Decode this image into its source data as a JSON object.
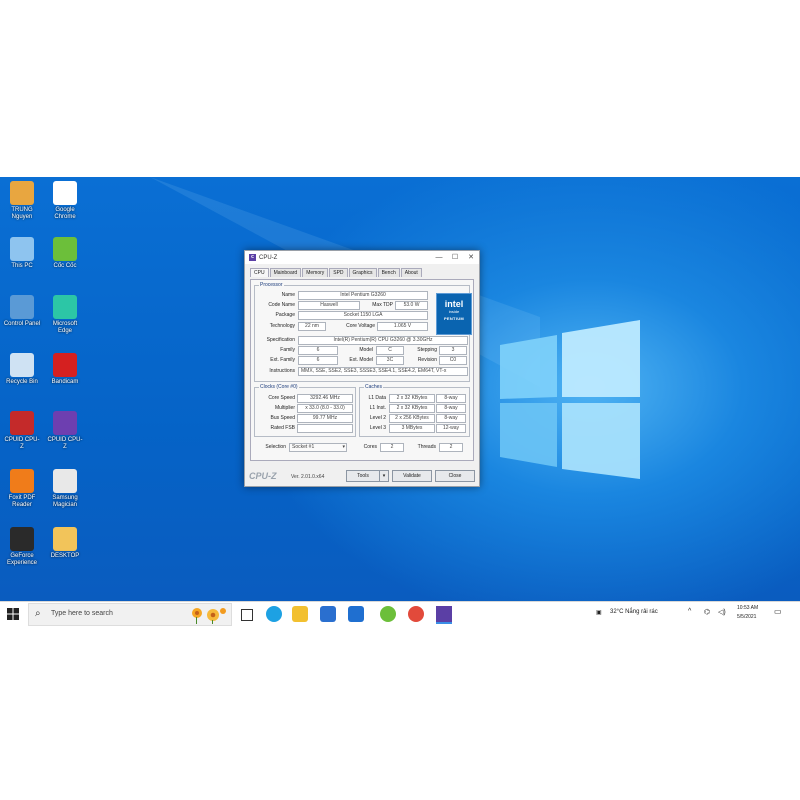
{
  "desktop_icons": [
    {
      "label": "TRUNG Nguyen",
      "color": "#e8a640"
    },
    {
      "label": "Google Chrome",
      "color": "#ffffff"
    },
    {
      "label": "This PC",
      "color": "#8ec4ef"
    },
    {
      "label": "Cốc Cốc",
      "color": "#6cbf3a"
    },
    {
      "label": "Control Panel",
      "color": "#5a9ad6"
    },
    {
      "label": "Microsoft Edge",
      "color": "#2cc6a6"
    },
    {
      "label": "Recycle Bin",
      "color": "#cfe2f3"
    },
    {
      "label": "Bandicam",
      "color": "#d52020"
    },
    {
      "label": "CPUID CPU-Z",
      "color": "#c42a2a"
    },
    {
      "label": "CPUID CPU-Z",
      "color": "#6d3fb0"
    },
    {
      "label": "Foxit PDF Reader",
      "color": "#f07c1a"
    },
    {
      "label": "Samsung Magician",
      "color": "#e8e8e8"
    },
    {
      "label": "GeForce Experience",
      "color": "#2a2a2a"
    },
    {
      "label": "DESKTOP",
      "color": "#f2c45a"
    }
  ],
  "cpuz": {
    "title": "CPU-Z",
    "tabs": [
      "CPU",
      "Mainboard",
      "Memory",
      "SPD",
      "Graphics",
      "Bench",
      "About"
    ],
    "processor": {
      "group_title": "Processor",
      "name_label": "Name",
      "name": "Intel Pentium G3260",
      "codename_label": "Code Name",
      "codename": "Haswell",
      "maxtdp_label": "Max TDP",
      "maxtdp": "53.0 W",
      "package_label": "Package",
      "package": "Socket 1150 LGA",
      "technology_label": "Technology",
      "technology": "22 nm",
      "corevoltage_label": "Core Voltage",
      "corevoltage": "1.065 V",
      "spec_label": "Specification",
      "spec": "Intel(R) Pentium(R) CPU G3260 @ 3.30GHz",
      "family_label": "Family",
      "family": "6",
      "model_label": "Model",
      "model": "C",
      "stepping_label": "Stepping",
      "stepping": "3",
      "extfamily_label": "Ext. Family",
      "extfamily": "6",
      "extmodel_label": "Ext. Model",
      "extmodel": "3C",
      "revision_label": "Revision",
      "revision": "C0",
      "instr_label": "Instructions",
      "instr": "MMX, SSE, SSE2, SSE3, SSSE3, SSE4.1, SSE4.2, EM64T, VT-x"
    },
    "intel_badge": {
      "brand": "intel",
      "inside": "inside",
      "product": "PENTIUM"
    },
    "clocks": {
      "group_title": "Clocks (Core #0)",
      "core_speed_label": "Core Speed",
      "core_speed": "3292.46 MHz",
      "multiplier_label": "Multiplier",
      "multiplier": "x 33.0 (8.0 - 33.0)",
      "bus_speed_label": "Bus Speed",
      "bus_speed": "99.77 MHz",
      "rated_fsb_label": "Rated FSB",
      "rated_fsb": ""
    },
    "caches": {
      "group_title": "Caches",
      "rows": [
        {
          "label": "L1 Data",
          "size": "2 x 32 KBytes",
          "way": "8-way"
        },
        {
          "label": "L1 Inst.",
          "size": "2 x 32 KBytes",
          "way": "8-way"
        },
        {
          "label": "Level 2",
          "size": "2 x 256 KBytes",
          "way": "8-way"
        },
        {
          "label": "Level 3",
          "size": "3 MBytes",
          "way": "12-way"
        }
      ]
    },
    "selection_label": "Selection",
    "selection": "Socket #1",
    "cores_label": "Cores",
    "cores": "2",
    "threads_label": "Threads",
    "threads": "2",
    "logo": "CPU-Z",
    "version": "Ver. 2.01.0.x64",
    "tools_label": "Tools",
    "validate_label": "Validate",
    "close_label": "Close"
  },
  "taskbar": {
    "search_placeholder": "Type here to search",
    "apps": [
      {
        "name": "task-view",
        "color": "#333333"
      },
      {
        "name": "edge",
        "color": "#1da1e3"
      },
      {
        "name": "file-explorer",
        "color": "#f2c030"
      },
      {
        "name": "store",
        "color": "#2a6fcf"
      },
      {
        "name": "mail",
        "color": "#1f6fd0"
      },
      {
        "name": "coc-coc",
        "color": "#6cbf3a"
      },
      {
        "name": "chrome",
        "color": "#e24a3b"
      },
      {
        "name": "cpu-z",
        "color": "#5b3fa5"
      }
    ],
    "weather": "32°C Nắng rải rác",
    "time": "10:53 AM",
    "date": "5/5/2021"
  }
}
